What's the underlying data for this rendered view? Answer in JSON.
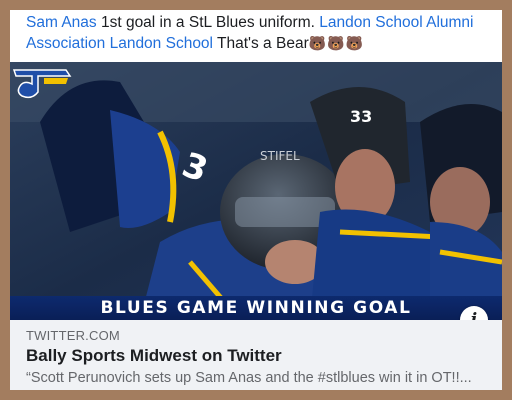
{
  "post": {
    "mention_1": "Sam Anas",
    "text_1": " 1st goal in a StL Blues uniform. ",
    "mention_2": "Landon School Alumni Association",
    "text_2": " ",
    "mention_3": "Landon School",
    "text_3": " That's a Bear",
    "emoji": "🐻🐻🐻"
  },
  "media": {
    "banner_text": "BLUES GAME WINNING GOAL",
    "jersey_number_left": "3",
    "jersey_number_right": "33",
    "helmet_text": "STIFEL",
    "info_icon_glyph": "i"
  },
  "link_preview": {
    "domain": "TWITTER.COM",
    "title": "Bally Sports Midwest on Twitter",
    "description": "“Scott Perunovich sets up Sam Anas and the #stlblues win it in OT!!..."
  },
  "colors": {
    "link": "#216fdb",
    "frame": "#a37d5f",
    "banner": "#0d2a6e",
    "preview_bg": "#f0f2f5"
  }
}
